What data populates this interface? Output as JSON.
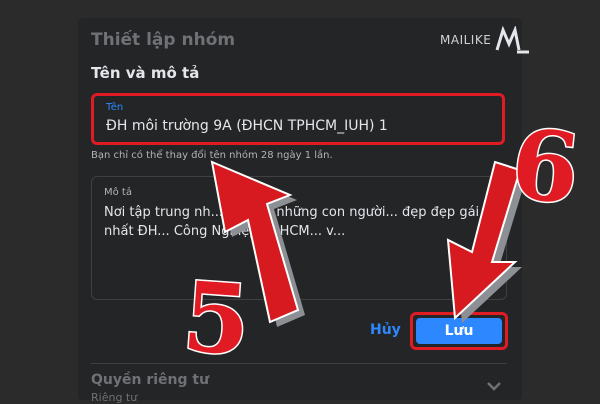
{
  "dialog": {
    "title": "Thiết lập nhóm",
    "section_title": "Tên và mô tả"
  },
  "watermark": {
    "text": "MAILIKE"
  },
  "name_field": {
    "label": "Tên",
    "value": "ĐH môi trường 9A (ĐHCN TPHCM_IUH) 1"
  },
  "name_hint": "Bạn chỉ có thể thay đổi tên nhóm 28 ngày 1 lần.",
  "description_field": {
    "label": "Mô tả",
    "value": "Nơi tập trung nh... phần... những con người... đẹp đẹp gái nhất ĐH... Công Nghiệp TP.HCM... v..."
  },
  "buttons": {
    "cancel_label": "Hủy",
    "save_label": "Lưu"
  },
  "privacy": {
    "title": "Quyền riêng tư",
    "subtitle": "Riêng tư"
  },
  "annotations": {
    "step_5": "5",
    "step_6": "6"
  },
  "colors": {
    "accent": "#2d88ff",
    "highlight": "#e01b24",
    "panel": "#242526"
  }
}
